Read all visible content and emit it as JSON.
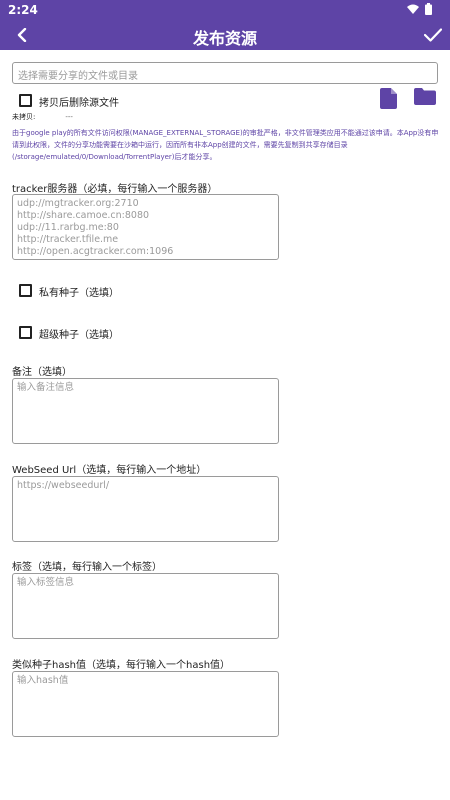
{
  "status_bar": {
    "time": "2:24"
  },
  "app_bar": {
    "title": "发布资源"
  },
  "file_select": {
    "placeholder": "选择需要分享的文件或目录"
  },
  "delete_source": {
    "label": "拷贝后删除源文件",
    "checked": false
  },
  "copy_status": {
    "label": "未拷贝:",
    "value": "---"
  },
  "notice": "由于google play的所有文件访问权限(MANAGE_EXTERNAL_STORAGE)的审批严格，非文件管理类应用不能通过该申请。本App没有申请到此权限，文件的分享功能需要在沙箱中运行，因而所有非本App创建的文件，需要先复制到共享存储目录(/storage/emulated/0/Download/TorrentPlayer)后才能分享。",
  "tracker": {
    "label": "tracker服务器（必填，每行输入一个服务器）",
    "lines": [
      "udp://mgtracker.org:2710",
      "http://share.camoe.cn:8080",
      "udp://11.rarbg.me:80",
      "http://tracker.tfile.me",
      "http://open.acgtracker.com:1096"
    ]
  },
  "private_torrent": {
    "label": "私有种子（选填）",
    "checked": false
  },
  "super_seed": {
    "label": "超级种子（选填）",
    "checked": false
  },
  "comment": {
    "label": "备注（选填）",
    "placeholder": "输入备注信息"
  },
  "webseed": {
    "label": "WebSeed Url（选填，每行输入一个地址）",
    "placeholder": "https://webseedurl/"
  },
  "tags": {
    "label": "标签（选填，每行输入一个标签）",
    "placeholder": "输入标签信息"
  },
  "similar": {
    "label": "类似种子hash值（选填，每行输入一个hash值）",
    "placeholder": "输入hash值"
  },
  "colors": {
    "primary": "#5e44a6",
    "border": "#9a9a9a",
    "placeholder": "#9a9a9a"
  }
}
